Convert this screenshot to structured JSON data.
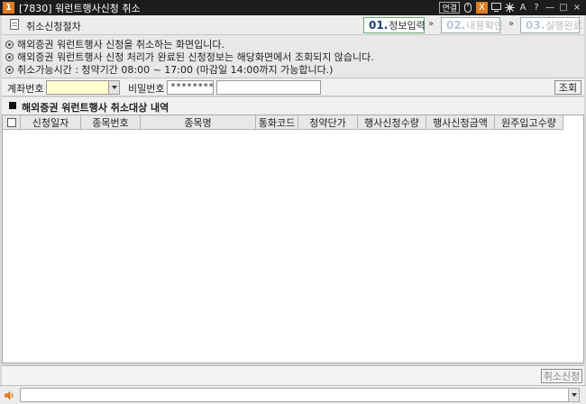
{
  "window": {
    "number": "1",
    "title": "[7830] 워런트행사신청 취소",
    "controls": [
      "연결",
      "mouse-icon",
      "X",
      "monitor-icon",
      "compass-icon",
      "A",
      "?",
      "—",
      "□",
      "×"
    ]
  },
  "steps": {
    "process_label": "취소신청절차",
    "items": [
      {
        "num": "01.",
        "label": "정보입력"
      },
      {
        "num": "02.",
        "label": "내용확인"
      },
      {
        "num": "03.",
        "label": "실행완료"
      }
    ],
    "separator": "»"
  },
  "info": [
    "해외증권 워런트행사 신청을 취소하는 화면입니다.",
    "해외증권 워런트행사 신청 처리가 완료된 신청정보는 해당화면에서 조회되지 않습니다.",
    "취소가능시간 : 청약기간 08:00 ~ 17:00 (마감일 14:00까지 가능합니다.)"
  ],
  "form": {
    "account_label": "계좌번호",
    "account_value": "",
    "password_label": "비밀번호",
    "password_value": "********",
    "name_value": "",
    "query_button": "조회"
  },
  "section": {
    "title": "해외증권 워런트행사 취소대상 내역"
  },
  "table": {
    "columns": [
      "신청일자",
      "종목번호",
      "종목명",
      "통화코드",
      "청약단가",
      "행사신청수량",
      "행사신청금액",
      "원주입고수량"
    ],
    "rows": []
  },
  "footer": {
    "cancel_button": "취소신청"
  },
  "status": {
    "message": ""
  }
}
